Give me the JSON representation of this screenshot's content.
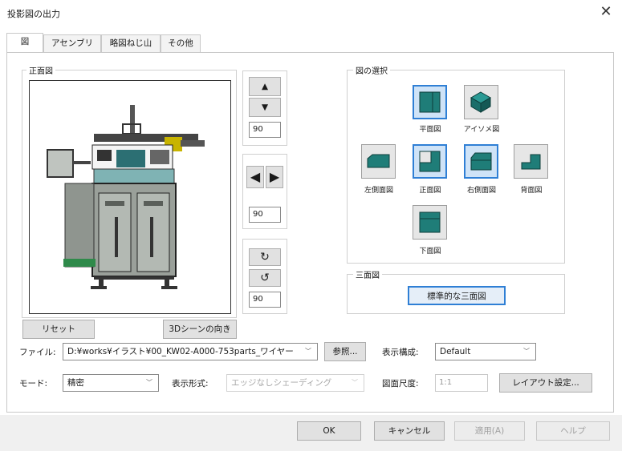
{
  "window": {
    "title": "投影図の出力"
  },
  "tabs": [
    {
      "label": "図"
    },
    {
      "label": "アセンブリ"
    },
    {
      "label": "略図ねじ山"
    },
    {
      "label": "その他"
    }
  ],
  "front_view": {
    "group_title": "正面図"
  },
  "rotation": {
    "vertical_angle": "90",
    "horizontal_angle": "90",
    "rotate_angle": "90"
  },
  "view_select": {
    "group_title": "図の選択",
    "views": [
      {
        "label": "平面図"
      },
      {
        "label": "アイソメ図"
      },
      {
        "label": "左側面図"
      },
      {
        "label": "正面図"
      },
      {
        "label": "右側面図"
      },
      {
        "label": "背面図"
      },
      {
        "label": "下面図"
      }
    ]
  },
  "three_view": {
    "group_title": "三面図",
    "button_label": "標準的な三面図"
  },
  "buttons": {
    "reset": "リセット",
    "scene_direction": "3Dシーンの向き",
    "browse": "参照...",
    "layout_settings": "レイアウト設定..."
  },
  "file": {
    "label": "ファイル:",
    "value": "D:¥works¥イラスト¥00_KW02-A000-753parts_ワイヤー"
  },
  "display_config": {
    "label": "表示構成:",
    "value": "Default"
  },
  "mode": {
    "label": "モード:",
    "value": "精密"
  },
  "display_format": {
    "label": "表示形式:",
    "value": "エッジなしシェーディング"
  },
  "drawing_scale": {
    "label": "図面尺度:",
    "value": "1:1"
  },
  "footer": {
    "ok": "OK",
    "cancel": "キャンセル",
    "apply": "適用(A)",
    "help": "ヘルプ"
  },
  "colors": {
    "accent": "#2f7fd5",
    "view_fill": "#1f7d78",
    "machine_gray": "#9aa09a"
  }
}
